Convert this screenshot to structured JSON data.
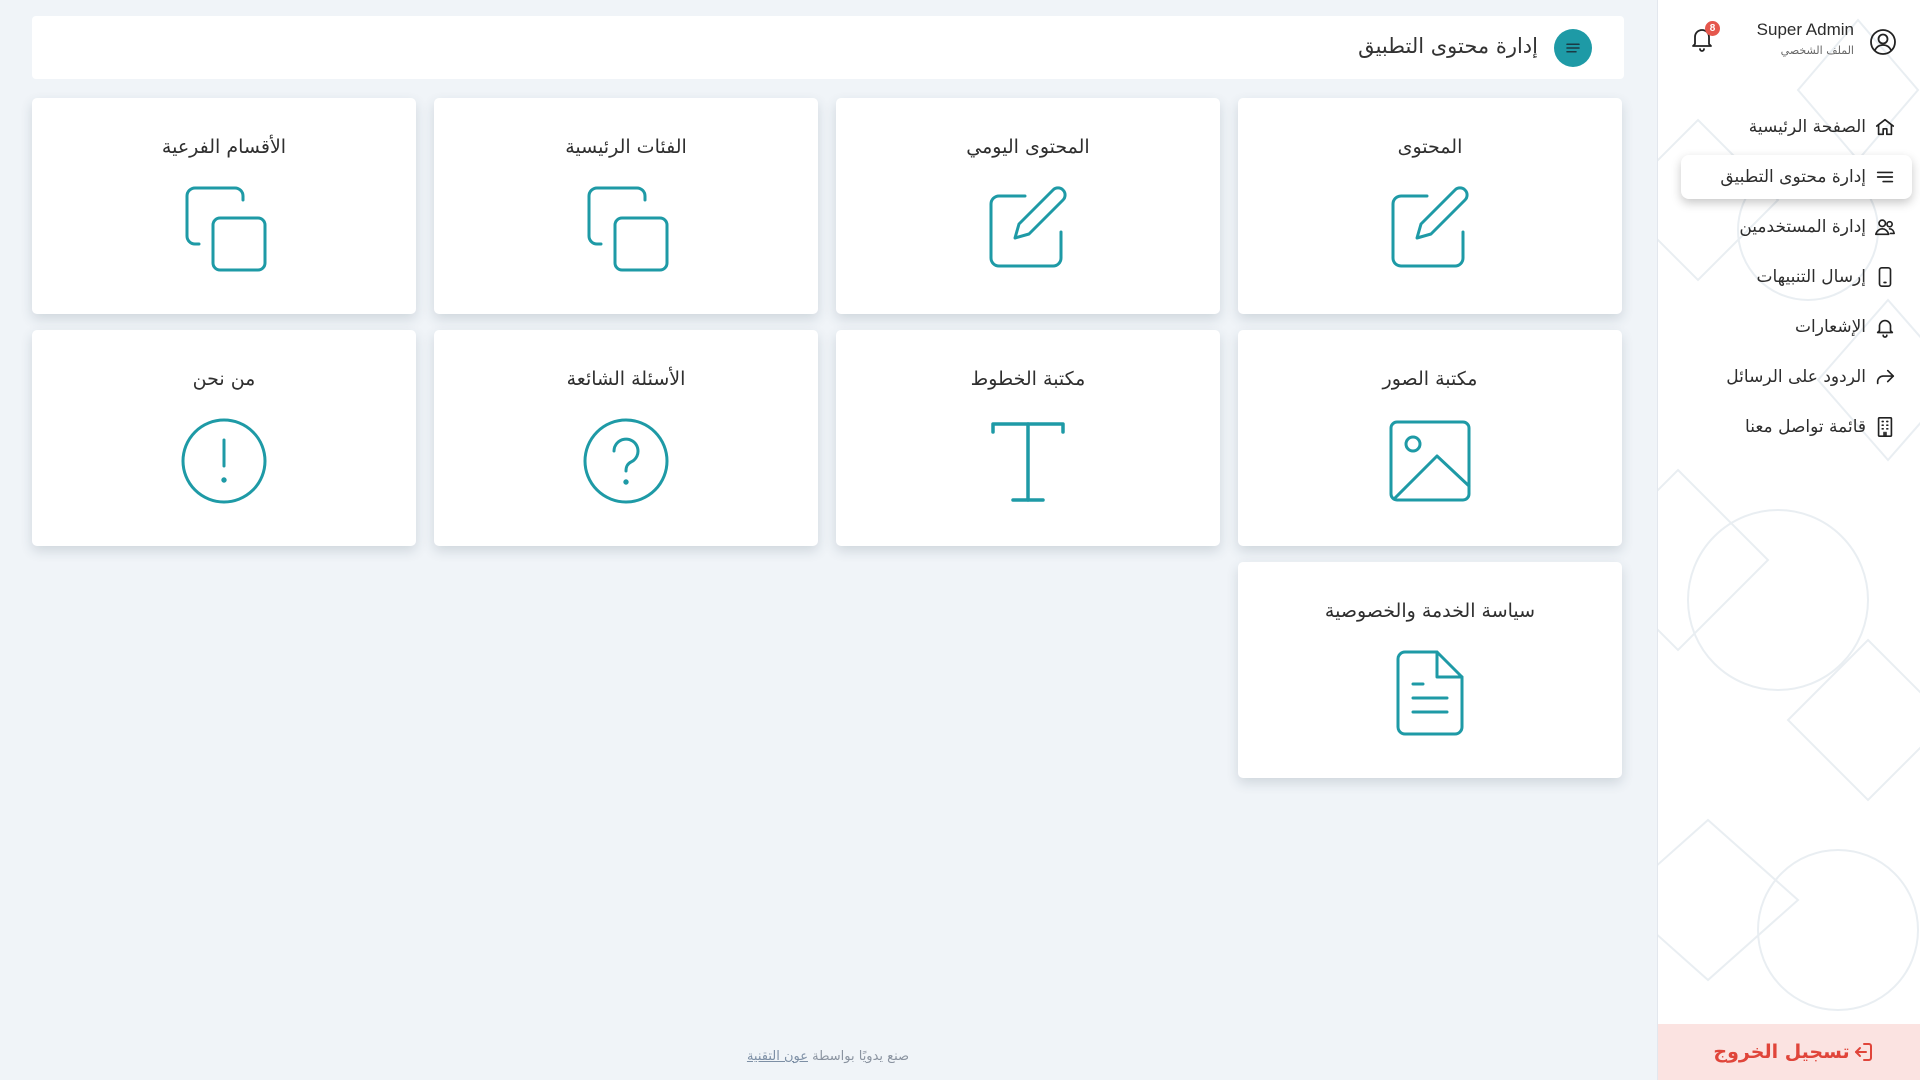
{
  "header": {
    "title": "إدارة محتوى التطبيق"
  },
  "profile": {
    "name": "Super Admin",
    "subtitle": "الملف الشخصي",
    "notification_count": "8"
  },
  "sidebar": {
    "items": [
      {
        "label": "الصفحة الرئيسية",
        "icon": "home-icon"
      },
      {
        "label": "إدارة محتوى التطبيق",
        "icon": "menu-lines-icon",
        "active": true
      },
      {
        "label": "إدارة المستخدمين",
        "icon": "users-icon"
      },
      {
        "label": "إرسال التنبيهات",
        "icon": "phone-icon"
      },
      {
        "label": "الإشعارات",
        "icon": "bell-icon"
      },
      {
        "label": "الردود على الرسائل",
        "icon": "reply-arrow-icon"
      },
      {
        "label": "قائمة تواصل معنا",
        "icon": "building-icon"
      }
    ],
    "logout_label": "تسجيل الخروج"
  },
  "cards": [
    {
      "title": "المحتوى",
      "icon": "edit-icon"
    },
    {
      "title": "المحتوى اليومي",
      "icon": "edit-icon"
    },
    {
      "title": "الفئات الرئيسية",
      "icon": "copy-icon"
    },
    {
      "title": "الأقسام الفرعية",
      "icon": "copy-icon"
    },
    {
      "title": "مكتبة الصور",
      "icon": "image-icon"
    },
    {
      "title": "مكتبة الخطوط",
      "icon": "type-icon"
    },
    {
      "title": "الأسئلة الشائعة",
      "icon": "question-circle-icon"
    },
    {
      "title": "من نحن",
      "icon": "exclamation-circle-icon"
    },
    {
      "title": "سياسة الخدمة والخصوصية",
      "icon": "document-icon"
    }
  ],
  "footer": {
    "prefix": "صنع يدويًا بواسطة",
    "link": "عون التقنية"
  },
  "colors": {
    "accent": "#1e9aa6",
    "background": "#f0f4f8",
    "logout_bg": "#fbe3e1",
    "logout_text": "#e0453a",
    "badge": "#e5574d"
  }
}
